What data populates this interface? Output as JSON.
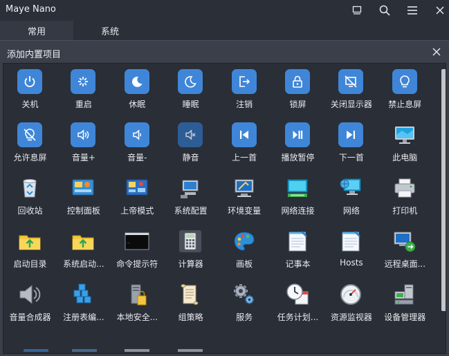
{
  "window": {
    "title": "Maye Nano"
  },
  "tabs": [
    {
      "label": "常用",
      "active": true
    },
    {
      "label": "系统",
      "active": false
    }
  ],
  "dialog": {
    "title": "添加内置项目"
  },
  "colors": {
    "accent": "#3f86d8",
    "background": "#2b2f38",
    "panel": "#2a2e37"
  },
  "scrollbar": {
    "position_fraction": 0.0
  },
  "items": [
    {
      "label": "关机",
      "icon": "power-icon"
    },
    {
      "label": "重启",
      "icon": "restart-icon"
    },
    {
      "label": "休眠",
      "icon": "moon-icon"
    },
    {
      "label": "睡眠",
      "icon": "moon-outline-icon"
    },
    {
      "label": "注销",
      "icon": "logout-icon"
    },
    {
      "label": "锁屏",
      "icon": "lock-icon"
    },
    {
      "label": "关闭显示器",
      "icon": "monitor-off-icon"
    },
    {
      "label": "禁止息屏",
      "icon": "bulb-icon"
    },
    {
      "label": "允许息屏",
      "icon": "bulb-off-icon"
    },
    {
      "label": "音量+",
      "icon": "volume-up-icon"
    },
    {
      "label": "音量-",
      "icon": "volume-down-icon"
    },
    {
      "label": "静音",
      "icon": "mute-icon"
    },
    {
      "label": "上一首",
      "icon": "previous-track-icon"
    },
    {
      "label": "播放暂停",
      "icon": "play-pause-icon"
    },
    {
      "label": "下一首",
      "icon": "next-track-icon"
    },
    {
      "label": "此电脑",
      "icon": "computer-icon"
    },
    {
      "label": "回收站",
      "icon": "recycle-bin-icon"
    },
    {
      "label": "控制面板",
      "icon": "control-panel-icon"
    },
    {
      "label": "上帝模式",
      "icon": "god-mode-icon"
    },
    {
      "label": "系统配置",
      "icon": "system-config-icon"
    },
    {
      "label": "环境变量",
      "icon": "environment-variables-icon"
    },
    {
      "label": "网络连接",
      "icon": "network-connections-icon"
    },
    {
      "label": "网络",
      "icon": "network-icon"
    },
    {
      "label": "打印机",
      "icon": "printer-icon"
    },
    {
      "label": "启动目录",
      "icon": "startup-folder-icon"
    },
    {
      "label": "系统启动...",
      "icon": "system-startup-folder-icon"
    },
    {
      "label": "命令提示符",
      "icon": "command-prompt-icon"
    },
    {
      "label": "计算器",
      "icon": "calculator-icon"
    },
    {
      "label": "画板",
      "icon": "paint-palette-icon"
    },
    {
      "label": "记事本",
      "icon": "notepad-icon"
    },
    {
      "label": "Hosts",
      "icon": "hosts-notepad-icon"
    },
    {
      "label": "远程桌面...",
      "icon": "remote-desktop-icon"
    },
    {
      "label": "音量合成器",
      "icon": "volume-mixer-icon"
    },
    {
      "label": "注册表编...",
      "icon": "registry-editor-icon"
    },
    {
      "label": "本地安全...",
      "icon": "local-security-icon"
    },
    {
      "label": "组策略",
      "icon": "group-policy-icon"
    },
    {
      "label": "服务",
      "icon": "services-gear-icon"
    },
    {
      "label": "任务计划...",
      "icon": "task-scheduler-icon"
    },
    {
      "label": "资源监视器",
      "icon": "resource-monitor-icon"
    },
    {
      "label": "设备管理器",
      "icon": "device-manager-icon"
    }
  ]
}
